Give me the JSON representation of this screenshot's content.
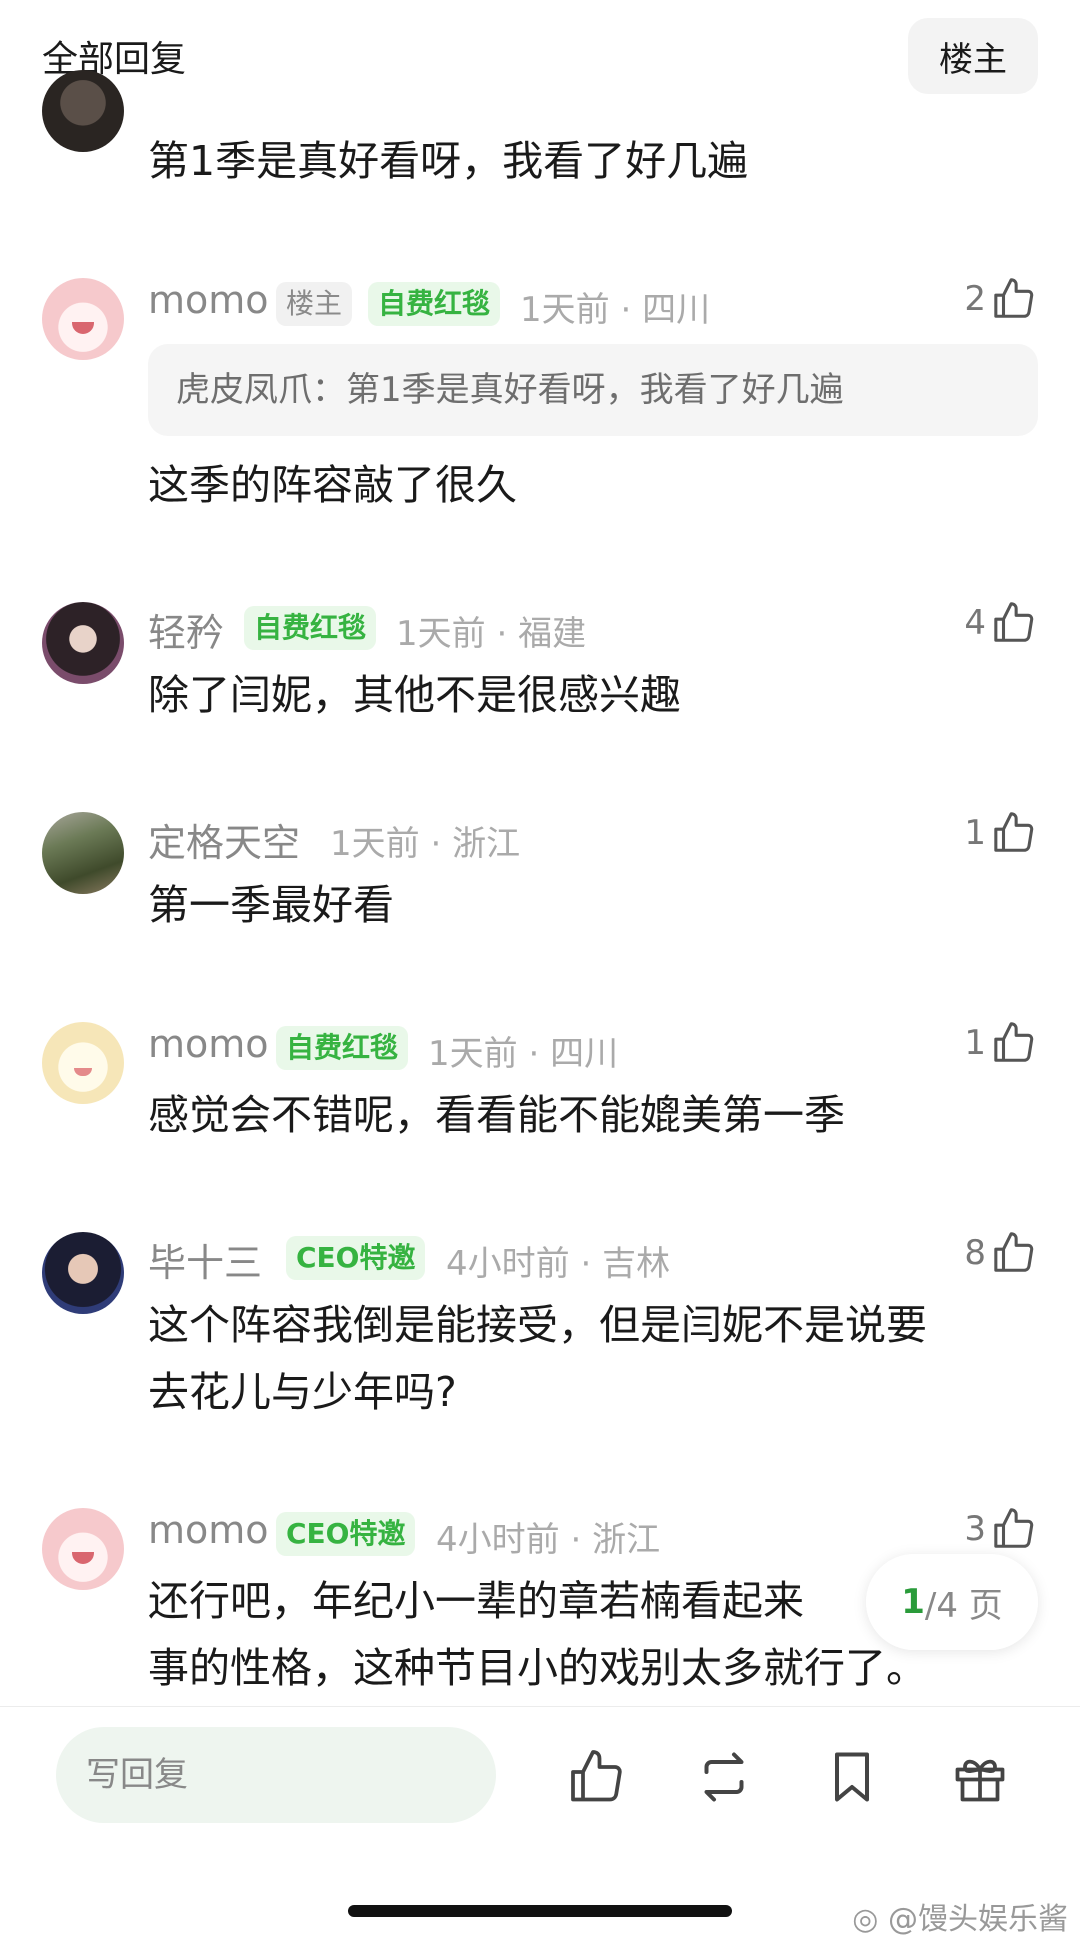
{
  "header": {
    "title": "全部回复",
    "op_filter_label": "楼主"
  },
  "top_partial": {
    "text": "第1季是真好看呀，我看了好几遍"
  },
  "comments": [
    {
      "username": "momo",
      "badges": [
        "楼主",
        "自费红毯"
      ],
      "time": "1天前",
      "location": "四川",
      "likes": "2",
      "quote": "虎皮凤爪：第1季是真好看呀，我看了好几遍",
      "text_lines": [
        "这季的阵容敲了很久"
      ],
      "avatar": "pink-mascot"
    },
    {
      "username": "轻矜",
      "badges": [
        "自费红毯"
      ],
      "time": "1天前",
      "location": "福建",
      "likes": "4",
      "text_lines": [
        "除了闫妮，其他不是很感兴趣"
      ],
      "avatar": "girl-photo"
    },
    {
      "username": "定格天空",
      "badges": [],
      "time": "1天前",
      "location": "浙江",
      "likes": "1",
      "text_lines": [
        "第一季最好看"
      ],
      "avatar": "road-photo"
    },
    {
      "username": "momo",
      "badges": [
        "自费红毯"
      ],
      "time": "1天前",
      "location": "四川",
      "likes": "1",
      "text_lines": [
        "感觉会不错呢，看看能不能媲美第一季"
      ],
      "avatar": "sheep-mascot"
    },
    {
      "username": "毕十三",
      "badges": [
        "CEO特邀"
      ],
      "time": "4小时前",
      "location": "吉林",
      "likes": "8",
      "text_lines": [
        "这个阵容我倒是能接受，但是闫妮不是说要",
        "去花儿与少年吗?"
      ],
      "avatar": "man-photo"
    },
    {
      "username": "momo",
      "badges": [
        "CEO特邀"
      ],
      "time": "4小时前",
      "location": "浙江",
      "likes": "3",
      "text_lines": [
        "还行吧，年纪小一辈的章若楠看起来",
        "事的性格，这种节目小的戏别太多就行了。"
      ],
      "avatar": "pink-mascot"
    }
  ],
  "pagination": {
    "current": "1",
    "total_label": "/4 页"
  },
  "bottom_bar": {
    "reply_placeholder": "写回复",
    "icons": [
      "like-icon",
      "repost-icon",
      "bookmark-icon",
      "gift-icon"
    ]
  },
  "watermark": {
    "text": "@馒头娱乐酱"
  },
  "colors": {
    "accent_green": "#36b341",
    "badge_green_bg": "#e9f8e9",
    "page_green": "#2a9b3a"
  }
}
